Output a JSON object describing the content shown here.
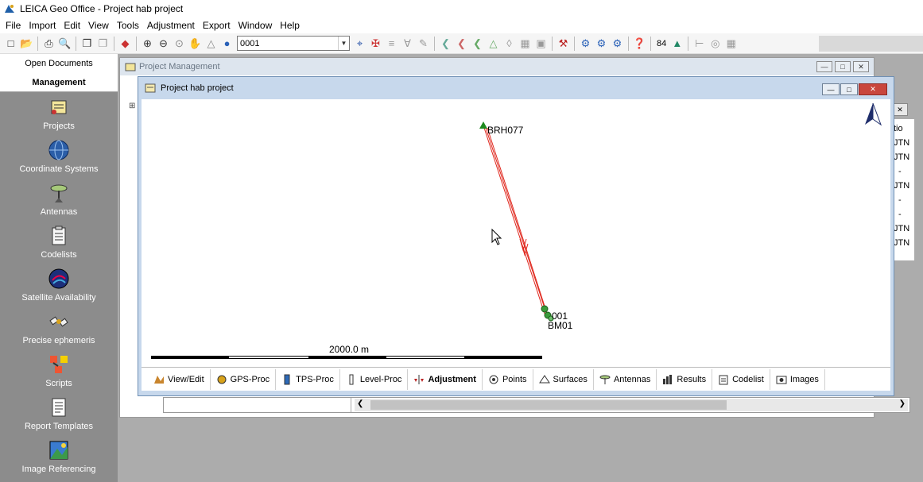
{
  "app": {
    "title": "LEICA Geo Office - Project hab project"
  },
  "menu": [
    "File",
    "Import",
    "Edit",
    "View",
    "Tools",
    "Adjustment",
    "Export",
    "Window",
    "Help"
  ],
  "toolbar": {
    "combo_value": "0001",
    "counter": "84"
  },
  "leftnav": {
    "tabs": [
      "Open Documents",
      "Management"
    ],
    "items": [
      {
        "label": "Projects",
        "icon": "projects-icon"
      },
      {
        "label": "Coordinate Systems",
        "icon": "globe-icon"
      },
      {
        "label": "Antennas",
        "icon": "antenna-icon"
      },
      {
        "label": "Codelists",
        "icon": "clipboard-icon"
      },
      {
        "label": "Satellite Availability",
        "icon": "satellite-availability-icon"
      },
      {
        "label": "Precise ephemeris",
        "icon": "satellite-icon"
      },
      {
        "label": "Scripts",
        "icon": "scripts-icon"
      },
      {
        "label": "Report Templates",
        "icon": "report-icon"
      },
      {
        "label": "Image Referencing",
        "icon": "image-referencing-icon"
      }
    ]
  },
  "pm_window": {
    "title": "Project Management",
    "right_column": [
      "tio",
      "JTN",
      "JTN",
      "-",
      "JTN",
      "-",
      "-",
      "JTN",
      "JTN"
    ]
  },
  "project_window": {
    "title": "Project hab project",
    "points": [
      {
        "name": "BRH077"
      },
      {
        "name": "001"
      },
      {
        "name": "BM01"
      }
    ],
    "scale_label": "2000.0 m",
    "tabs": [
      {
        "label": "View/Edit",
        "icon": "view-edit-icon"
      },
      {
        "label": "GPS-Proc",
        "icon": "gps-proc-icon"
      },
      {
        "label": "TPS-Proc",
        "icon": "tps-proc-icon"
      },
      {
        "label": "Level-Proc",
        "icon": "level-proc-icon"
      },
      {
        "label": "Adjustment",
        "icon": "adjustment-icon",
        "active": true
      },
      {
        "label": "Points",
        "icon": "points-icon"
      },
      {
        "label": "Surfaces",
        "icon": "surfaces-icon"
      },
      {
        "label": "Antennas",
        "icon": "antennas-icon"
      },
      {
        "label": "Results",
        "icon": "results-icon"
      },
      {
        "label": "Codelist",
        "icon": "codelist-icon"
      },
      {
        "label": "Images",
        "icon": "images-icon"
      }
    ]
  },
  "colors": {
    "nav_bg": "#8c8c8c",
    "line_red": "#e0281e",
    "point_green": "#1e8a1e",
    "window_frame": "#c7d8ec"
  }
}
